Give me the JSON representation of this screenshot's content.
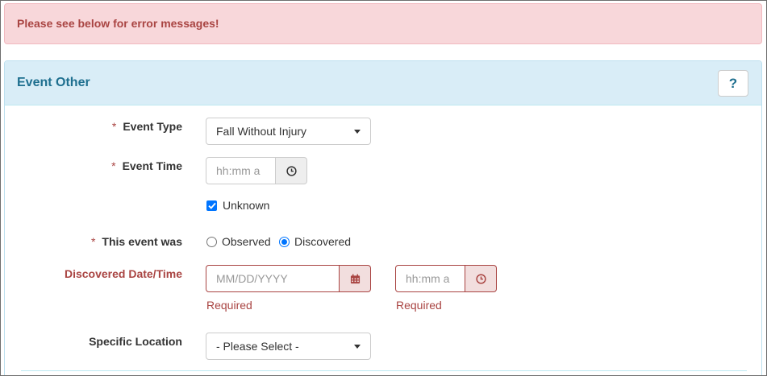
{
  "alert": {
    "message": "Please see below for error messages!"
  },
  "panel": {
    "title": "Event Other",
    "help_label": "?"
  },
  "form": {
    "event_type": {
      "label": "Event Type",
      "required_mark": "*",
      "value": "Fall Without Injury"
    },
    "event_time": {
      "label": "Event Time",
      "required_mark": "*",
      "placeholder": "hh:mm a",
      "icon": "clock-icon"
    },
    "unknown": {
      "label": "Unknown",
      "checked": true
    },
    "this_event_was": {
      "label": "This event was",
      "required_mark": "*",
      "options": [
        "Observed",
        "Discovered"
      ],
      "selected": "Discovered"
    },
    "discovered_datetime": {
      "label": "Discovered Date/Time",
      "date_placeholder": "MM/DD/YYYY",
      "time_placeholder": "hh:mm a",
      "date_error": "Required",
      "time_error": "Required",
      "date_icon": "calendar-icon",
      "time_icon": "clock-icon"
    },
    "specific_location": {
      "label": "Specific Location",
      "value": "- Please Select -"
    }
  },
  "colors": {
    "error": "#a94442",
    "alert_bg": "#f8d7da",
    "panel_heading_bg": "#d9edf7",
    "title": "#1e6f8f",
    "accent": "#0075ff"
  }
}
